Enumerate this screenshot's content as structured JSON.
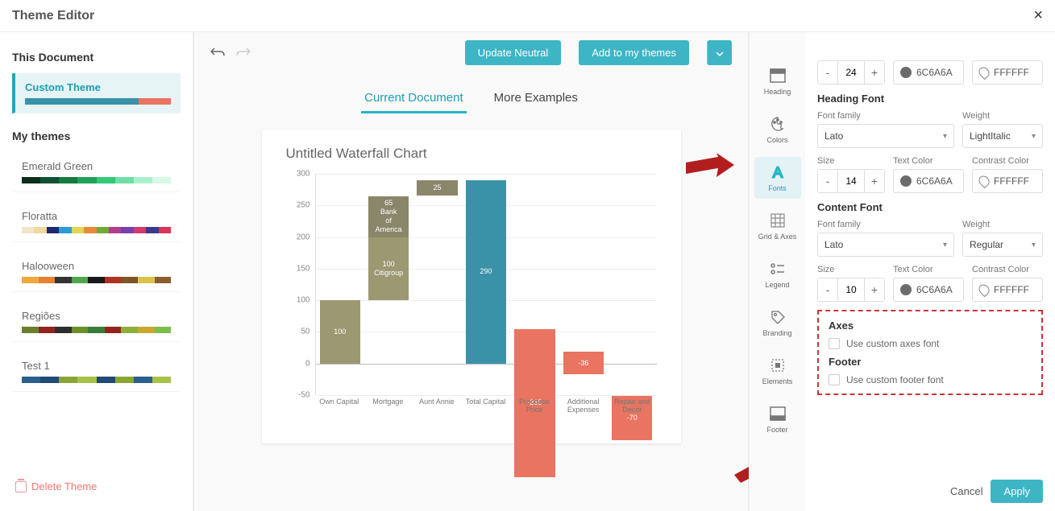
{
  "header": {
    "title": "Theme Editor"
  },
  "sidebar": {
    "section1_title": "This Document",
    "custom_theme": "Custom Theme",
    "section2_title": "My themes",
    "themes": [
      {
        "name": "Emerald Green",
        "colors": [
          "#0a2e1a",
          "#0f5132",
          "#147a3f",
          "#1ea25a",
          "#32c977",
          "#6fe0a5",
          "#a8f0cb",
          "#d7f9e6"
        ]
      },
      {
        "name": "Floratta",
        "colors": [
          "#f1e5c8",
          "#f0d8a0",
          "#1e2a6e",
          "#2e9ad1",
          "#e2d550",
          "#e78b3a",
          "#6fab3a",
          "#b03f8a",
          "#7a3fae",
          "#d6396e",
          "#3a3a8a",
          "#d93657"
        ]
      },
      {
        "name": "Halooween",
        "colors": [
          "#f0a83a",
          "#e7812e",
          "#333",
          "#4ea84a",
          "#1a1a1a",
          "#b03222",
          "#7d5528",
          "#d9c34a",
          "#8b5e2e"
        ]
      },
      {
        "name": "Regiões",
        "colors": [
          "#6a7f2e",
          "#91251e",
          "#2e2e2e",
          "#6b8f2b",
          "#3a7c3a",
          "#91251e",
          "#8fae3a",
          "#c9a82e",
          "#7bbf4a"
        ]
      },
      {
        "name": "Test 1",
        "colors": [
          "#2c5f8d",
          "#1f4a73",
          "#89a634",
          "#a8c147",
          "#1f4a73",
          "#89a634",
          "#2c5f8d",
          "#a8c147"
        ]
      }
    ],
    "delete": "Delete Theme"
  },
  "toolbar": {
    "update": "Update Neutral",
    "add": "Add to my themes"
  },
  "tabs": {
    "current": "Current Document",
    "more": "More Examples"
  },
  "categories": [
    "Heading",
    "Colors",
    "Fonts",
    "Grid & Axes",
    "Legend",
    "Branding",
    "Elements",
    "Footer"
  ],
  "chart_data": {
    "type": "waterfall",
    "title": "Untitled Waterfall Chart",
    "ylim": [
      -50,
      300
    ],
    "yticks": [
      -50,
      0,
      50,
      100,
      150,
      200,
      250,
      300
    ],
    "categories": [
      "Own Capital",
      "Mortgage",
      "Aunt Annie",
      "Total Capital",
      "Purchase Price",
      "Additional Expenses",
      "Repair and Decor"
    ],
    "bars": [
      {
        "segments": [
          {
            "label": "100",
            "value": 100,
            "color": "#9c9872",
            "y0": 0
          }
        ]
      },
      {
        "segments": [
          {
            "label": "100 Citigroup",
            "value": 100,
            "color": "#9c9872",
            "y0": 100
          },
          {
            "label": "65 Bank of America",
            "value": 65,
            "color": "#8a866a",
            "y0": 200
          }
        ]
      },
      {
        "segments": [
          {
            "label": "25",
            "value": 25,
            "color": "#8a866a",
            "y0": 265
          }
        ]
      },
      {
        "segments": [
          {
            "label": "290",
            "value": 290,
            "color": "#3a92a8",
            "y0": 0
          }
        ],
        "total": true
      },
      {
        "segments": [
          {
            "label": "-235",
            "value": -235,
            "color": "#e87461",
            "y0": 55
          }
        ]
      },
      {
        "segments": [
          {
            "label": "-36",
            "value": -36,
            "color": "#e87461",
            "y0": 19
          }
        ]
      },
      {
        "segments": [
          {
            "label": "-70",
            "value": -70,
            "color": "#e87461",
            "y0": -51
          }
        ]
      }
    ]
  },
  "props": {
    "size1": "24",
    "tcolor1": "6C6A6A",
    "ccolor1": "FFFFFF",
    "heading_font_label": "Heading Font",
    "family_label": "Font family",
    "weight_label": "Weight",
    "size_label": "Size",
    "tcolor_label": "Text Color",
    "ccolor_label": "Contrast Color",
    "family1": "Lato",
    "weight1": "LightItalic",
    "size2": "14",
    "tcolor2": "6C6A6A",
    "ccolor2": "FFFFFF",
    "content_font_label": "Content Font",
    "family2": "Lato",
    "weight2": "Regular",
    "size3": "10",
    "tcolor3": "6C6A6A",
    "ccolor3": "FFFFFF",
    "axes_label": "Axes",
    "axes_cb": "Use custom axes font",
    "footer_label": "Footer",
    "footer_cb": "Use custom footer font"
  },
  "footer_btns": {
    "cancel": "Cancel",
    "apply": "Apply"
  }
}
